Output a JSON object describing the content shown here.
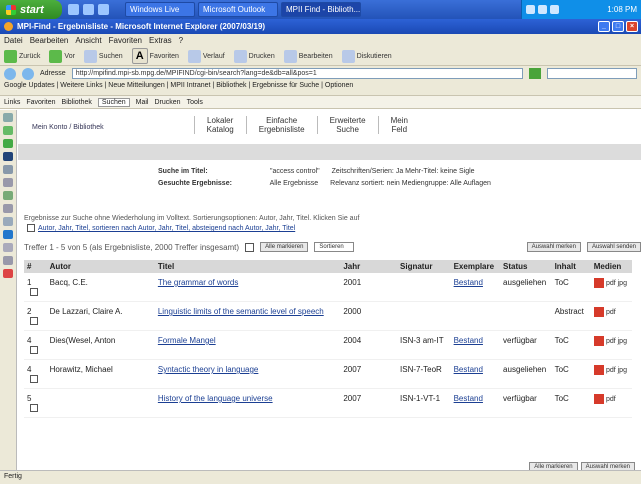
{
  "taskbar": {
    "start": "start",
    "tasks": [
      "Windows Live",
      "Microsoft Outlook",
      "MPII Find - Biblioth..."
    ],
    "clock": "1:08 PM"
  },
  "window": {
    "title": "MPI-Find - Ergebnisliste - Microsoft Internet Explorer (2007/03/19)"
  },
  "menu": [
    "Datei",
    "Bearbeiten",
    "Ansicht",
    "Favoriten",
    "Extras",
    "?"
  ],
  "toolbar": [
    "Zurück",
    "Vor",
    "Suchen",
    "Favoriten",
    "Verlauf",
    "Drucken",
    "Bearbeiten",
    "Diskutieren"
  ],
  "address": {
    "label": "Adresse",
    "value": "http://mpifind.mpi-sb.mpg.de/MPIFIND/cgi-bin/search?lang=de&db=all&pos=1"
  },
  "links_row": "Google Updates  |  Weitere Links  |  Neue Mitteilungen  |  MPII Intranet  |  Bibliothek  |  Ergebnisse für Suche  |  Optionen",
  "bookmarks": [
    "Links",
    "Favoriten",
    "Bibliothek",
    "Suchen",
    "Mail",
    "Drucken",
    "Tools"
  ],
  "top": {
    "mylink": "Mein Konto / Bibliothek",
    "tabs": [
      {
        "line1": "Lokaler",
        "line2": "Katalog"
      },
      {
        "line1": "Einfache",
        "line2": "Ergebnisliste"
      },
      {
        "line1": "Erweiterte",
        "line2": "Suche"
      },
      {
        "line1": "Mein",
        "line2": "Feld"
      }
    ]
  },
  "search": {
    "row1_label": "Suche im Titel:",
    "row1_value": "\"access control\"",
    "row1_extra": "Zeitschriften/Serien: Ja   Mehr-Titel: keine Sigle",
    "row2_label": "Gesuchte Ergebnisse:",
    "row2_value": "Alle Ergebnisse",
    "row2_extra": "Relevanz sortiert: nein   Mediengruppe: Alle Auflagen"
  },
  "note": {
    "text": "Ergebnisse zur Suche ohne Wiederholung im Volltext. Sortierungsoptionen: Autor, Jahr, Titel. Klicken Sie auf",
    "links": "Autor, Jahr, Titel, sortieren nach Autor, Jahr, Titel, absteigend nach Autor, Jahr, Titel"
  },
  "results": {
    "summary": "Treffer 1 - 5 von 5 (als Ergebnisliste, 2000 Treffer insgesamt)",
    "btn_all": "Alle markieren",
    "sel_placeholder": "Sortieren",
    "btn_mark": "Auswahl merken",
    "btn_send": "Auswahl senden"
  },
  "table": {
    "headers": [
      "#",
      "Autor",
      "Titel",
      "Jahr",
      "Signatur",
      "Exemplare",
      "Status",
      "Inhalt",
      "Medien"
    ],
    "rows": [
      {
        "num": "1",
        "author": "Bacq, C.E.",
        "title": "The grammar of words",
        "year": "2001",
        "sig": "",
        "loc": "Bestand",
        "status": "ausgeliehen",
        "content": "ToC",
        "media": "pdf jpg"
      },
      {
        "num": "2",
        "author": "De Lazzari, Claire A.",
        "title": "Linguistic limits of the semantic level of speech",
        "year": "2000",
        "sig": "",
        "loc": "",
        "status": "",
        "content": "Abstract",
        "media": "pdf"
      },
      {
        "num": "4",
        "author": "Dies(Wesel, Anton",
        "title": "Formale Mangel",
        "year": "2004",
        "sig": "ISN-3 am-IT",
        "loc": "Bestand",
        "status": "verfügbar",
        "content": "ToC",
        "media": "pdf jpg"
      },
      {
        "num": "4",
        "author": "Horawitz, Michael",
        "title": "Syntactic theory in language",
        "year": "2007",
        "sig": "ISN-7-TeoR",
        "loc": "Bestand",
        "status": "ausgeliehen",
        "content": "ToC",
        "media": "pdf jpg"
      },
      {
        "num": "5",
        "author": "",
        "title": "History of the language universe",
        "year": "2007",
        "sig": "ISN-1-VT-1",
        "loc": "Bestand",
        "status": "verfügbar",
        "content": "ToC",
        "media": "pdf"
      }
    ]
  },
  "bottom": {
    "btn1": "Alle markieren",
    "btn2": "Auswahl merken"
  },
  "status": "Fertig"
}
